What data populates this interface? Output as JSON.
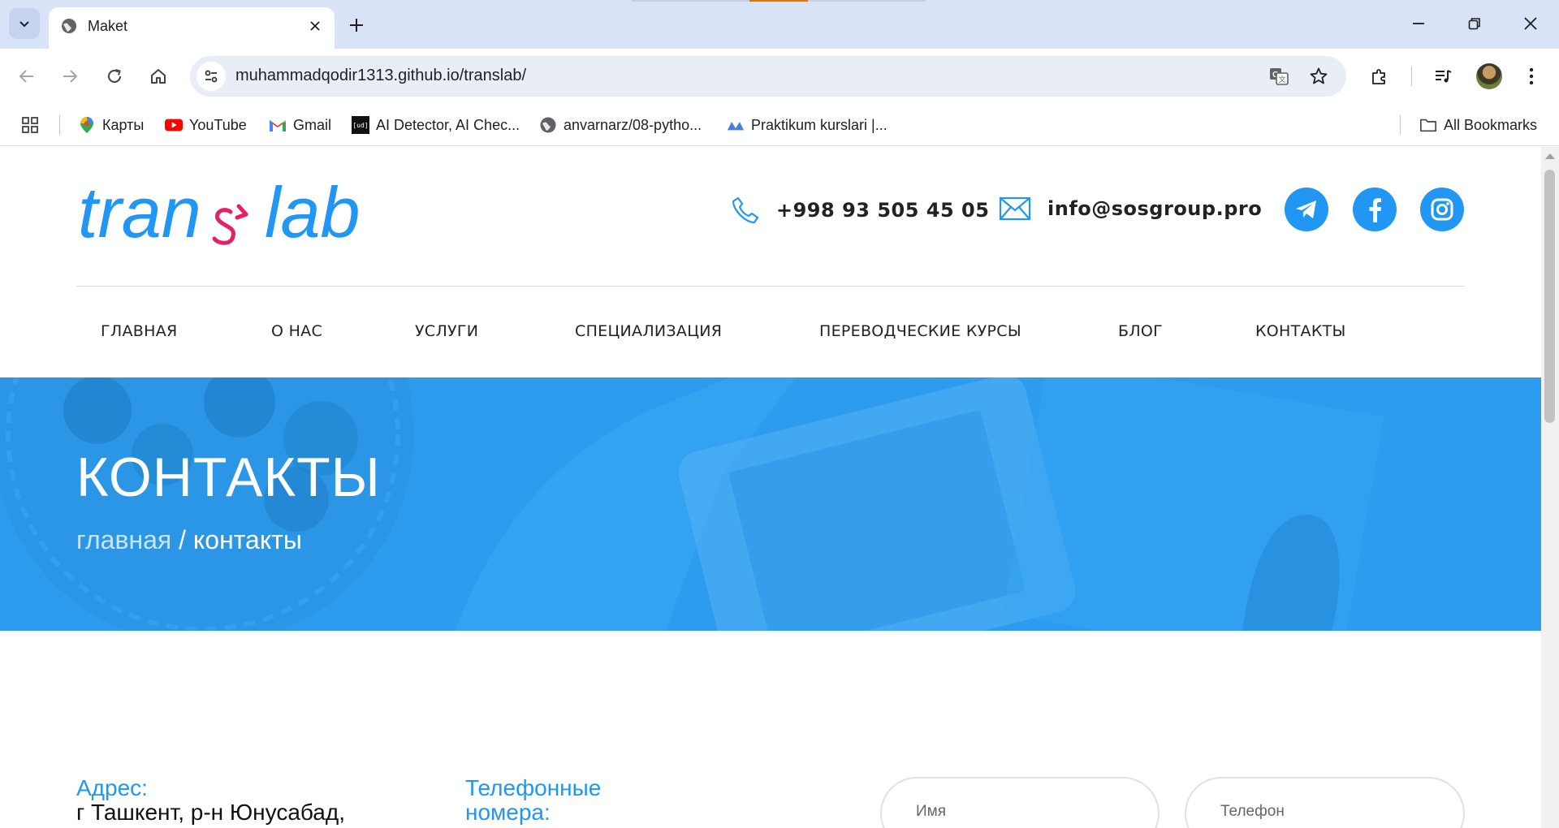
{
  "browser": {
    "tab_title": "Maket",
    "url": "muhammadqodir1313.github.io/translab/",
    "bookmarks": [
      {
        "label": "Карты",
        "icon": "maps-icon"
      },
      {
        "label": "YouTube",
        "icon": "youtube-icon"
      },
      {
        "label": "Gmail",
        "icon": "gmail-icon"
      },
      {
        "label": "AI Detector, AI Chec...",
        "icon": "ud-icon"
      },
      {
        "label": "anvarnarz/08-pytho...",
        "icon": "globe-icon"
      },
      {
        "label": "Praktikum kurslari |...",
        "icon": "praktikum-icon"
      }
    ],
    "all_bookmarks": "All Bookmarks"
  },
  "header": {
    "logo": {
      "part1": "tran",
      "part2": "lab"
    },
    "phone": "+998 93 505 45 05",
    "email": "info@sosgroup.pro",
    "socials": [
      "telegram-icon",
      "facebook-icon",
      "instagram-icon"
    ]
  },
  "menu": [
    "ГЛАВНАЯ",
    "О НАС",
    "УСЛУГИ",
    "СПЕЦИАЛИЗАЦИЯ",
    "ПЕРЕВОДЧЕСКИЕ КУРСЫ",
    "БЛОГ",
    "КОНТАКТЫ"
  ],
  "hero": {
    "title": "КОНТАКТЫ",
    "breadcrumb_home": "главная",
    "breadcrumb_sep": "/",
    "breadcrumb_current": "контакты"
  },
  "info": {
    "address_label": "Адрес:",
    "address_value": "г Ташкент, р-н Юнусабад,",
    "phones_label_1": "Телефонные",
    "phones_label_2": "номера:"
  },
  "form": {
    "name_placeholder": "Имя",
    "phone_placeholder": "Телефон"
  },
  "colors": {
    "brand_blue": "#2196f3",
    "hero_blue": "#2d9cee",
    "logo_accent": "#e91e63"
  }
}
